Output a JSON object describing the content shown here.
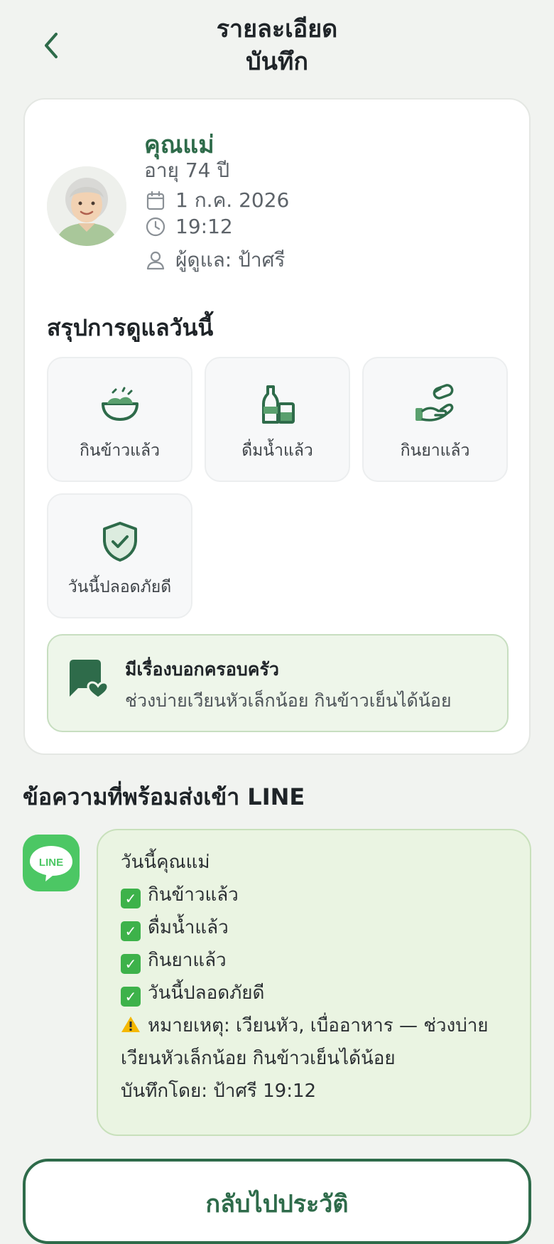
{
  "header": {
    "title": "รายละเอียด\nบันทึก"
  },
  "profile": {
    "name": "คุณแม่",
    "age": "อายุ 74 ปี",
    "date": "1 ก.ค. 2026",
    "time": "19:12",
    "caregiver": "ผู้ดูแล: ป้าศรี"
  },
  "summary": {
    "title": "สรุปการดูแลวันนี้",
    "items": [
      {
        "icon": "rice-bowl-icon",
        "label": "กินข้าวแล้ว"
      },
      {
        "icon": "water-bottle-icon",
        "label": "ดื่มน้ำแล้ว"
      },
      {
        "icon": "pill-hand-icon",
        "label": "กินยาแล้ว"
      },
      {
        "icon": "shield-check-icon",
        "label": "วันนี้ปลอดภัยดี"
      }
    ]
  },
  "note": {
    "title": "มีเรื่องบอกครอบครัว",
    "text": "ช่วงบ่ายเวียนหัวเล็กน้อย กินข้าวเย็นได้น้อย"
  },
  "line_section": {
    "title": "ข้อความที่พร้อมส่งเข้า LINE",
    "logo_text": "LINE",
    "message": {
      "greeting": "วันนี้คุณแม่",
      "checks": [
        "กินข้าวแล้ว",
        "ดื่มน้ำแล้ว",
        "กินยาแล้ว",
        "วันนี้ปลอดภัยดี"
      ],
      "warning": "หมายเหตุ: เวียนหัว, เบื่ออาหาร — ช่วงบ่ายเวียนหัวเล็กน้อย กินข้าวเย็นได้น้อย",
      "footer": "บันทึกโดย: ป้าศรี 19:12"
    }
  },
  "actions": {
    "back_to_history": "กลับไปประวัติ"
  },
  "colors": {
    "accent": "#2e6b4a",
    "line_green": "#4cc764",
    "note_bg": "#eef6ea"
  }
}
